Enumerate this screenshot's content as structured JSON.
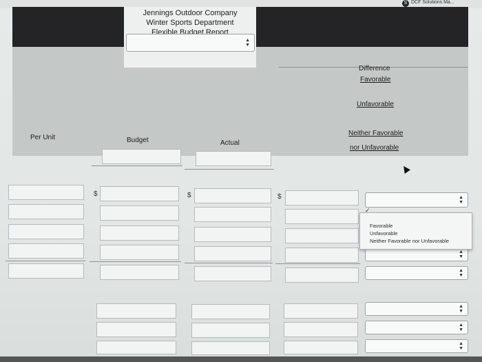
{
  "topbar": {
    "solutions_label": "DCF Solutions Ma..."
  },
  "report": {
    "company": "Jennings Outdoor Company",
    "department": "Winter Sports Department",
    "title": "Flexible Budget Report"
  },
  "columns": {
    "per_unit": "Per Unit",
    "budget": "Budget",
    "actual": "Actual",
    "difference": "Difference",
    "favorable": "Favorable",
    "unfavorable": "Unfavorable",
    "neither_line1": "Neither Favorable",
    "neither_line2": "nor Unfavorable"
  },
  "currency_symbol": "$",
  "dropdown_options": [
    "Favorable",
    "Unfavorable",
    "Neither Favorable nor Unfavorable"
  ],
  "icons": {
    "select_arrow": "up-down-arrows-icon",
    "check": "checkmark-icon",
    "cursor": "mouse-pointer-icon"
  }
}
